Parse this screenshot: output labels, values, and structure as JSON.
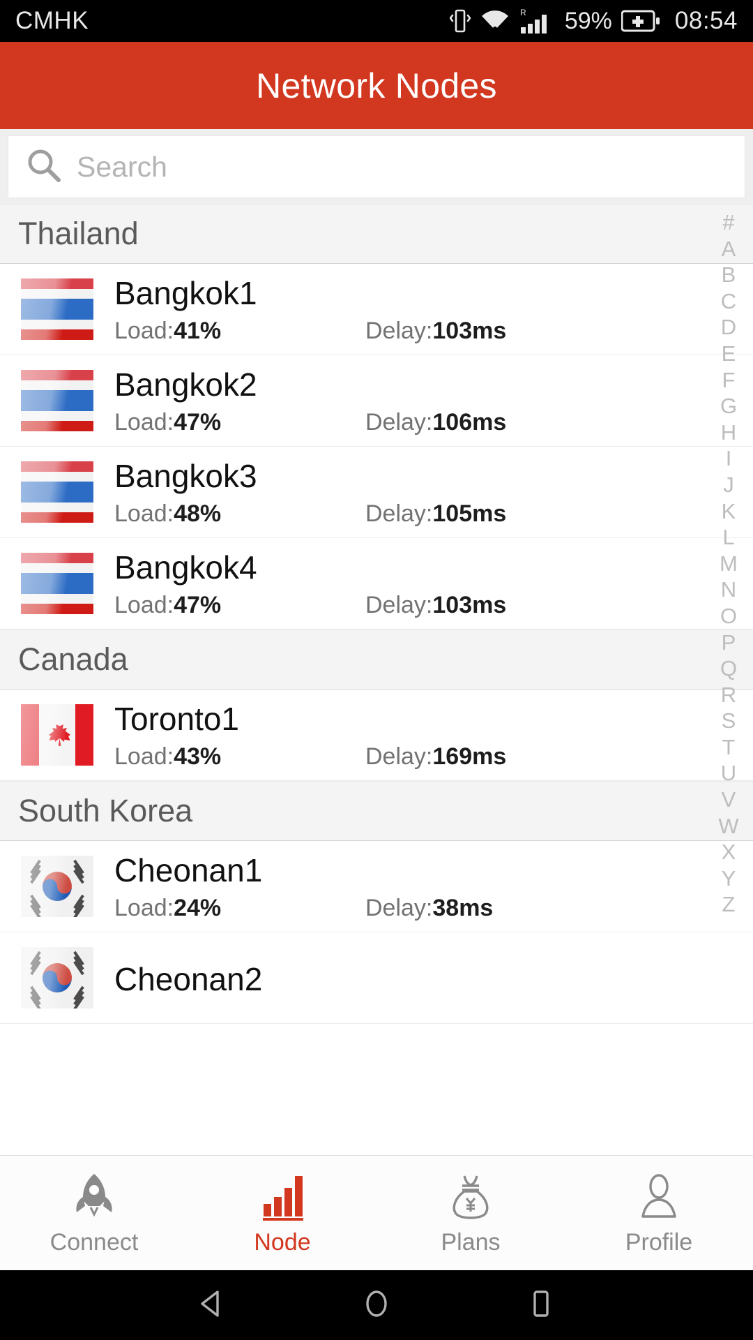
{
  "status_bar": {
    "carrier": "CMHK",
    "battery_percent": "59%",
    "clock": "08:54",
    "roaming_label": "R",
    "icons": [
      "vibrate-icon",
      "wifi-icon",
      "signal-icon",
      "battery-charging-icon"
    ]
  },
  "app_bar": {
    "title": "Network Nodes",
    "background_color": "#d2371f"
  },
  "search": {
    "placeholder": "Search",
    "value": "",
    "icon": "search-icon"
  },
  "alpha_index": [
    "#",
    "A",
    "B",
    "C",
    "D",
    "E",
    "F",
    "G",
    "H",
    "I",
    "J",
    "K",
    "L",
    "M",
    "N",
    "O",
    "P",
    "Q",
    "R",
    "S",
    "T",
    "U",
    "V",
    "W",
    "X",
    "Y",
    "Z"
  ],
  "labels": {
    "load_prefix": "Load:",
    "delay_prefix": "Delay:"
  },
  "sections": [
    {
      "country": "Thailand",
      "flag": "thailand-flag",
      "nodes": [
        {
          "name": "Bangkok1",
          "load": "41%",
          "delay": "103ms"
        },
        {
          "name": "Bangkok2",
          "load": "47%",
          "delay": "106ms"
        },
        {
          "name": "Bangkok3",
          "load": "48%",
          "delay": "105ms"
        },
        {
          "name": "Bangkok4",
          "load": "47%",
          "delay": "103ms"
        }
      ]
    },
    {
      "country": "Canada",
      "flag": "canada-flag",
      "nodes": [
        {
          "name": "Toronto1",
          "load": "43%",
          "delay": "169ms"
        }
      ]
    },
    {
      "country": "South Korea",
      "flag": "south-korea-flag",
      "nodes": [
        {
          "name": "Cheonan1",
          "load": "24%",
          "delay": "38ms"
        },
        {
          "name": "Cheonan2",
          "load": "",
          "delay": ""
        }
      ]
    }
  ],
  "tabs": [
    {
      "label": "Connect",
      "icon": "rocket-icon",
      "active": false
    },
    {
      "label": "Node",
      "icon": "bar-chart-icon",
      "active": true
    },
    {
      "label": "Plans",
      "icon": "money-bag-icon",
      "active": false
    },
    {
      "label": "Profile",
      "icon": "person-icon",
      "active": false
    }
  ],
  "android_nav": {
    "back": "back-triangle-icon",
    "home": "home-circle-icon",
    "recents": "recents-square-icon"
  },
  "colors": {
    "accent": "#d2371f",
    "section_bg": "#f4f4f4",
    "inactive_tab": "#8a8a8a"
  }
}
